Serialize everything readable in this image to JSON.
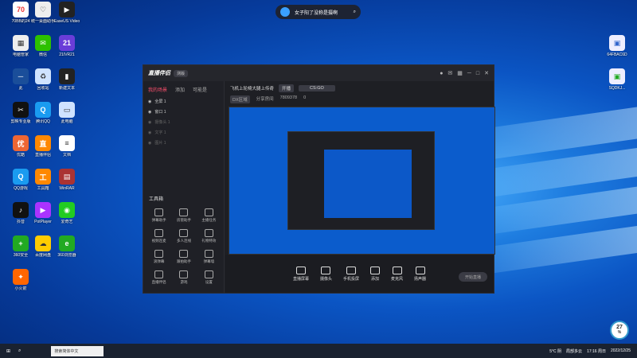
{
  "search_pill": {
    "text": "女子阳了没称是摄啊"
  },
  "desktop_icons": [
    {
      "label": "70BB的24",
      "color": "#fff",
      "fg": "#e33",
      "glyph": "70"
    },
    {
      "label": "统一桌面助手",
      "color": "#eee",
      "fg": "#333",
      "glyph": "♡"
    },
    {
      "label": "EaseUS Video",
      "color": "#222",
      "fg": "#fff",
      "glyph": "▶"
    },
    {
      "label": "电脑管家",
      "color": "#eee",
      "fg": "#333",
      "glyph": "▦"
    },
    {
      "label": "微信",
      "color": "#2dc100",
      "fg": "#fff",
      "glyph": "✉"
    },
    {
      "label": "21IVR21",
      "color": "#6a3dd8",
      "fg": "#fff",
      "glyph": "21"
    },
    {
      "label": "此",
      "color": "#1a4e9a",
      "fg": "#fff",
      "glyph": "─"
    },
    {
      "label": "回收站",
      "color": "#cfe3ff",
      "fg": "#333",
      "glyph": "♻"
    },
    {
      "label": "新建文本",
      "color": "#222",
      "fg": "#fff",
      "glyph": "▮"
    },
    {
      "label": "剪映专业版",
      "color": "#111",
      "fg": "#fff",
      "glyph": "✂"
    },
    {
      "label": "腾讯QQ",
      "color": "#1a9bf0",
      "fg": "#fff",
      "glyph": "Q"
    },
    {
      "label": "此电脑",
      "color": "#cfe3ff",
      "fg": "#333",
      "glyph": "▭"
    },
    {
      "label": "优酷",
      "color": "#e63",
      "fg": "#fff",
      "glyph": "优"
    },
    {
      "label": "直播伴侣",
      "color": "#f80",
      "fg": "#fff",
      "glyph": "直"
    },
    {
      "label": "文档",
      "color": "#fff",
      "fg": "#333",
      "glyph": "≡"
    },
    {
      "label": "QQ游戏",
      "color": "#1a9bf0",
      "fg": "#fff",
      "glyph": "Q"
    },
    {
      "label": "工具箱",
      "color": "#f80",
      "fg": "#fff",
      "glyph": "工"
    },
    {
      "label": "WinRAR",
      "color": "#a33",
      "fg": "#fff",
      "glyph": "▤"
    },
    {
      "label": "抖音",
      "color": "#111",
      "fg": "#fff",
      "glyph": "♪"
    },
    {
      "label": "PotPlayer",
      "color": "#a3f",
      "fg": "#fff",
      "glyph": "▶"
    },
    {
      "label": "爱奇艺",
      "color": "#2c2",
      "fg": "#fff",
      "glyph": "◉"
    },
    {
      "label": "360安全",
      "color": "#2a2",
      "fg": "#fff",
      "glyph": "+"
    },
    {
      "label": "百度网盘",
      "color": "#fc0",
      "fg": "#333",
      "glyph": "☁"
    },
    {
      "label": "360浏览器",
      "color": "#2a2",
      "fg": "#fff",
      "glyph": "e"
    },
    {
      "label": "小火箭",
      "color": "#f60",
      "fg": "#fff",
      "glyph": "✦"
    }
  ],
  "right_icons": [
    {
      "label": "64FBAC6D",
      "color": "#eef",
      "fg": "#36c",
      "glyph": "▣"
    },
    {
      "label": "SQDKJ...",
      "color": "#eef",
      "fg": "#2a2",
      "glyph": "▣"
    }
  ],
  "app": {
    "logo": "直播伴侣",
    "version": "测版",
    "sidebar_tabs": [
      "我的场景",
      "添加",
      "可能是"
    ],
    "scenes": [
      {
        "label": "全屏 1",
        "dim": false
      },
      {
        "label": "窗口 1",
        "dim": false
      },
      {
        "label": "摄像头 1",
        "dim": true
      },
      {
        "label": "文字 1",
        "dim": true
      },
      {
        "label": "图片 1",
        "dim": true
      }
    ],
    "tools_title": "工具箱",
    "tools": [
      "弹幕助手",
      "房管助手",
      "主播任务",
      "视频连麦",
      "多人连线",
      "礼物特效",
      "滚弹幕",
      "跟拍助手",
      "弹幕墙",
      "直播伴侣",
      "游戏",
      "设置"
    ],
    "title": "飞机上轮椅大腿上传奇",
    "room_button": "开播",
    "category": "CS:GO",
    "tag_label": "DX区域",
    "share_label": "分享房间",
    "room_id": "7809378",
    "fans": "0",
    "bottom_buttons": [
      "直播屏幕",
      "摄像头",
      "手机投屏",
      "添加",
      "麦克风",
      "扬声器"
    ],
    "go_live": "开始直播"
  },
  "taskbar": {
    "search_placeholder": "搜索简体中文",
    "tray_temp": "5°C 阴",
    "tray_weather": "局部多云",
    "time": "17:16 周日",
    "date": "2022/12/25"
  },
  "gauge": {
    "value": "27",
    "unit": "%"
  }
}
